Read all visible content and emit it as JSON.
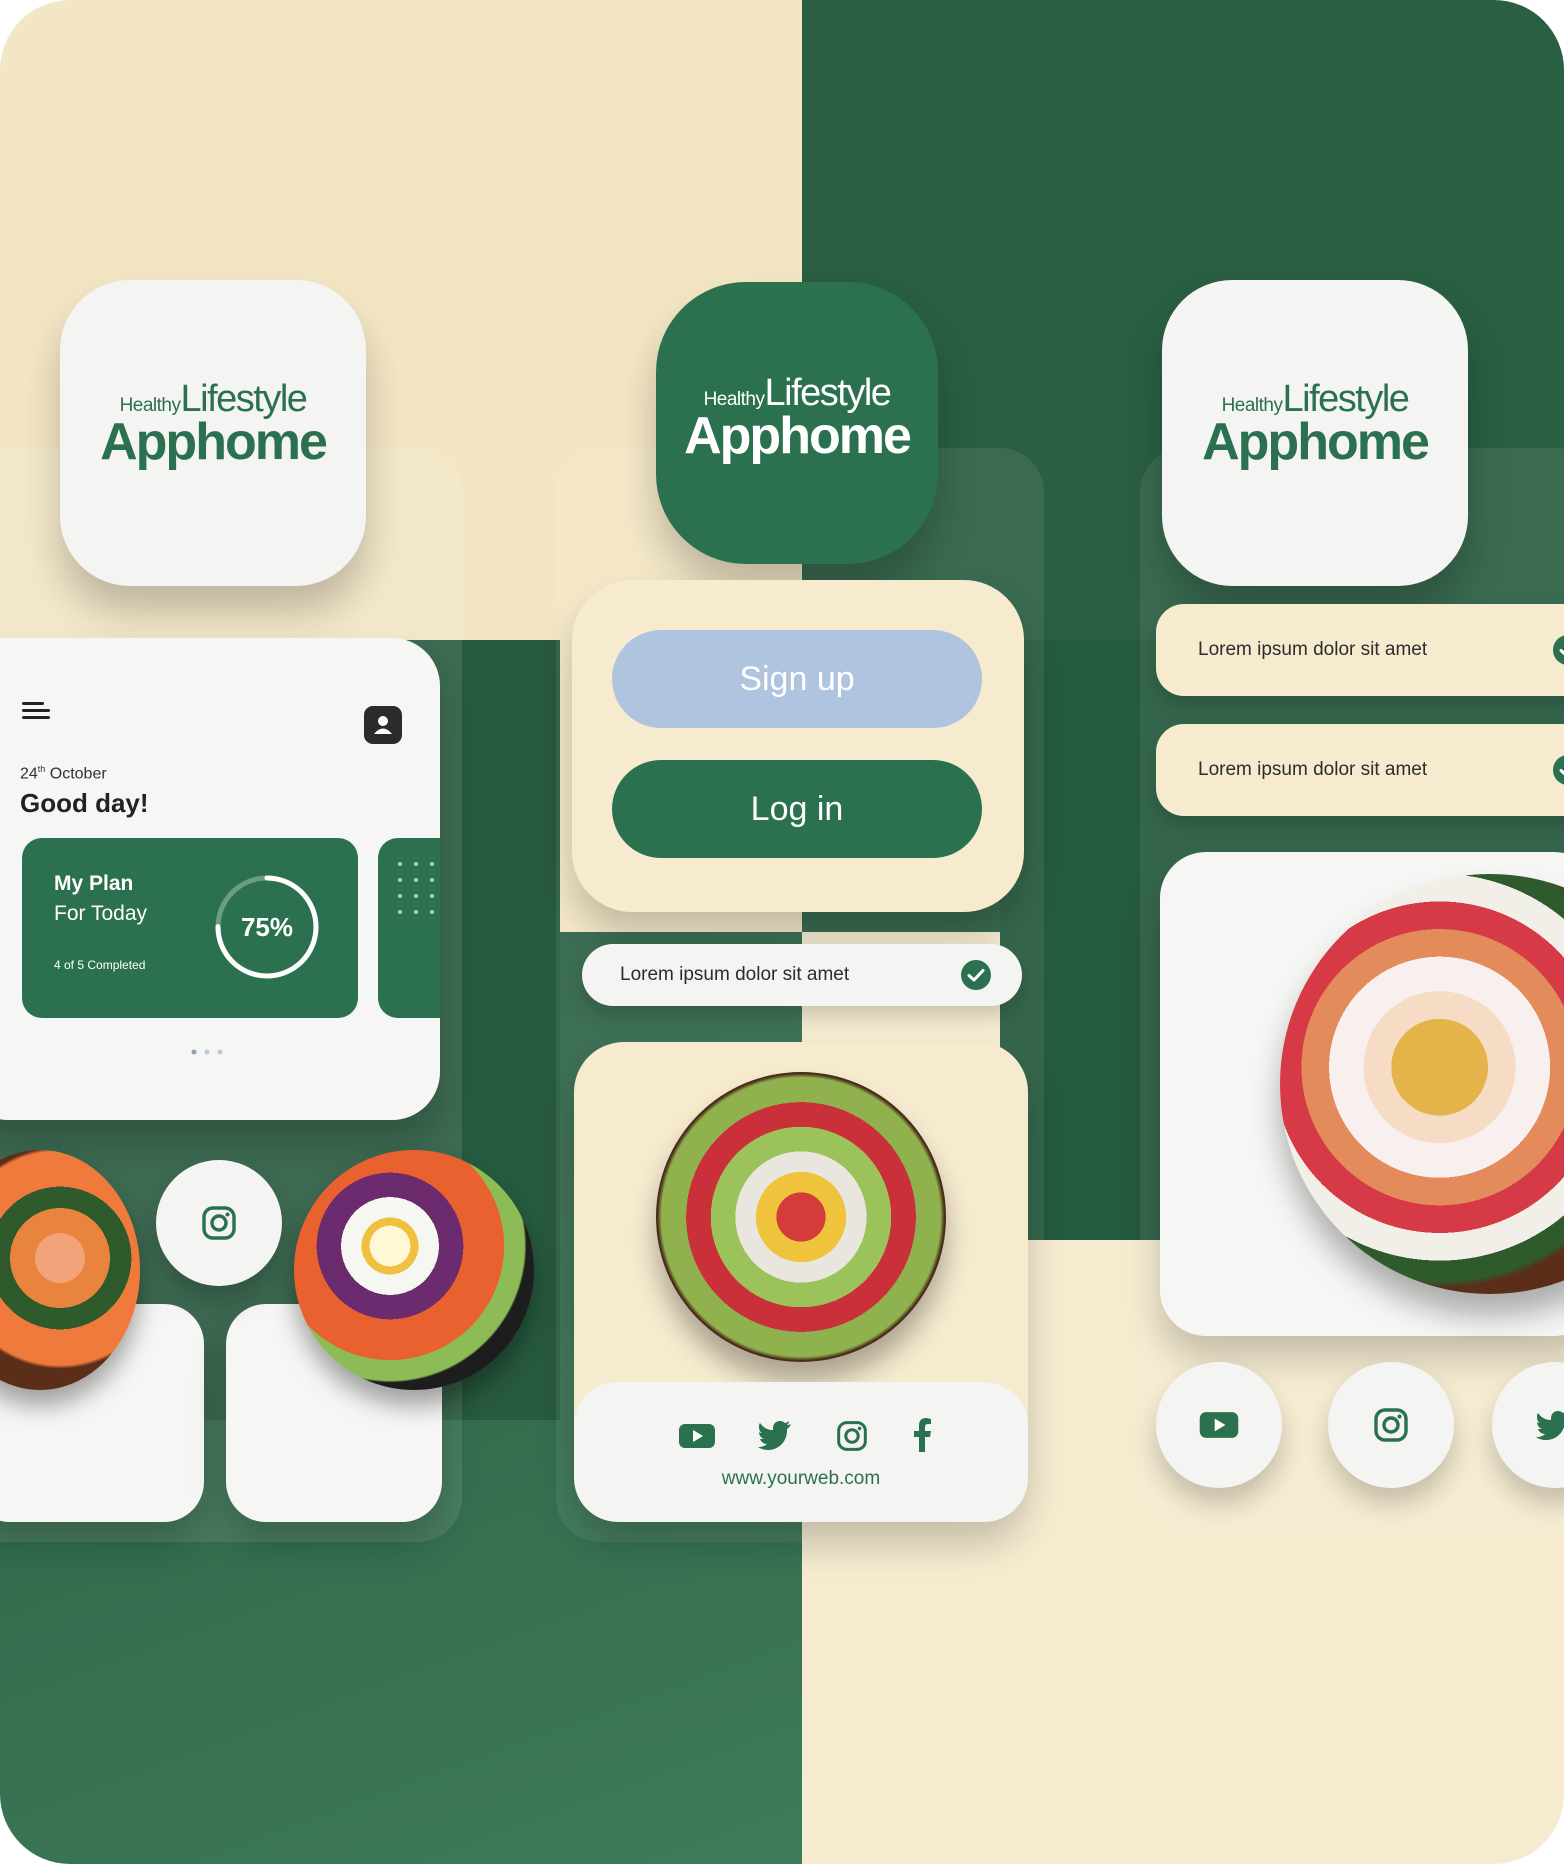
{
  "logo": {
    "small": "Healthy",
    "medium": "Lifestyle",
    "large": "Apphome"
  },
  "home_card": {
    "menu_icon": "menu-icon",
    "profile_icon": "user-icon",
    "date_day": "24",
    "date_suffix": "th",
    "date_month": "October",
    "greeting": "Good day!",
    "plan_title": "My Plan",
    "plan_subtitle": "For Today",
    "plan_progress_label": "75%",
    "plan_progress": 0.75,
    "plan_completed": "4 of 5 Completed"
  },
  "auth": {
    "signup_label": "Sign up",
    "login_label": "Log in"
  },
  "checklist": [
    "Lorem ipsum dolor sit amet",
    "Lorem ipsum dolor sit amet",
    "Lorem ipsum dolor sit amet"
  ],
  "social": {
    "icons": [
      "youtube-icon",
      "twitter-icon",
      "instagram-icon",
      "facebook-icon"
    ],
    "website": "www.yourweb.com"
  },
  "colors": {
    "brand_green": "#2b7150",
    "dark_green": "#2a5f43",
    "cream": "#f6ebcf",
    "signup_blue": "#aec4df"
  }
}
